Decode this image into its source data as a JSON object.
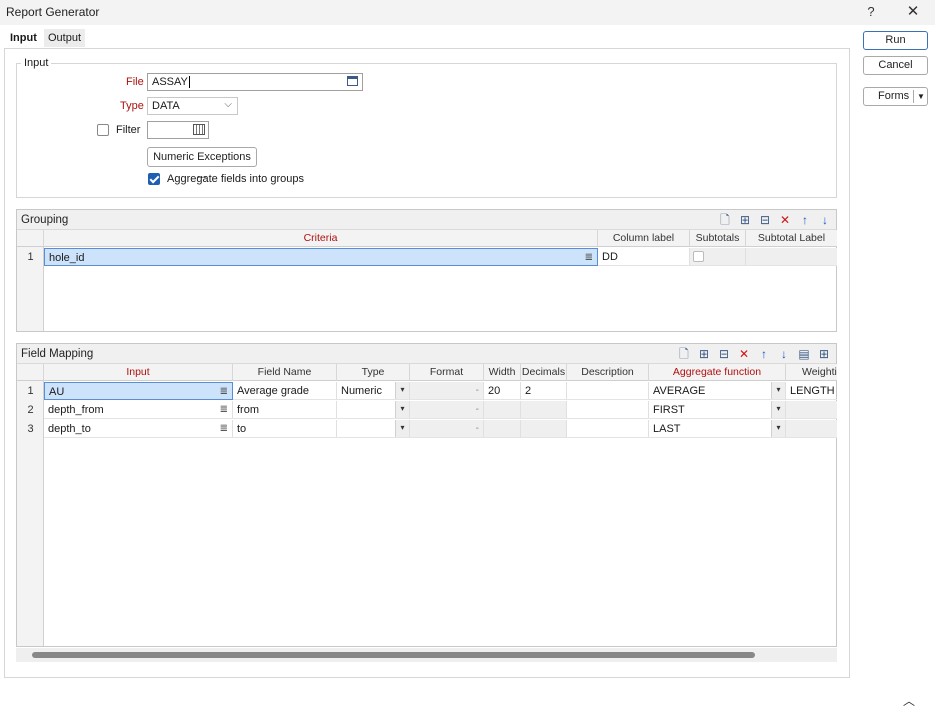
{
  "window": {
    "title": "Report Generator",
    "help_glyph": "?",
    "close_glyph": "✕"
  },
  "tabs": [
    {
      "label": "Input",
      "active": true
    },
    {
      "label": "Output",
      "active": false
    }
  ],
  "actions": {
    "run": "Run",
    "cancel": "Cancel",
    "forms": "Forms"
  },
  "input_group": {
    "legend": "Input",
    "file_label": "File",
    "file_value": "ASSAY",
    "type_label": "Type",
    "type_value": "DATA",
    "filter_label": "Filter",
    "filter_checked": false,
    "numeric_exceptions": "Numeric Exceptions ...",
    "aggregate_label": "Aggregate fields into groups",
    "aggregate_checked": true
  },
  "grouping": {
    "title": "Grouping",
    "columns": [
      "Criteria",
      "Column label",
      "Subtotals",
      "Subtotal Label"
    ],
    "rows": [
      {
        "num": "1",
        "criteria": "hole_id",
        "column_label": "DD",
        "subtotals": false,
        "subtotal_label": ""
      }
    ]
  },
  "field_mapping": {
    "title": "Field Mapping",
    "columns": [
      "Input",
      "Field Name",
      "Type",
      "Format",
      "Width",
      "Decimals",
      "Description",
      "Aggregate function",
      "Weighti"
    ],
    "rows": [
      {
        "num": "1",
        "input": "AU",
        "field_name": "Average grade",
        "type": "Numeric",
        "format": "",
        "width": "20",
        "decimals": "2",
        "description": "",
        "aggregate": "AVERAGE",
        "weighting": "LENGTH"
      },
      {
        "num": "2",
        "input": "depth_from",
        "field_name": "from",
        "type": "",
        "format": "",
        "width": "",
        "decimals": "",
        "description": "",
        "aggregate": "FIRST",
        "weighting": ""
      },
      {
        "num": "3",
        "input": "depth_to",
        "field_name": "to",
        "type": "",
        "format": "",
        "width": "",
        "decimals": "",
        "description": "",
        "aggregate": "LAST",
        "weighting": ""
      }
    ]
  },
  "colors": {
    "accent": "#1e5fb4",
    "required_label": "#b01010",
    "selection": "#cde3fb"
  }
}
